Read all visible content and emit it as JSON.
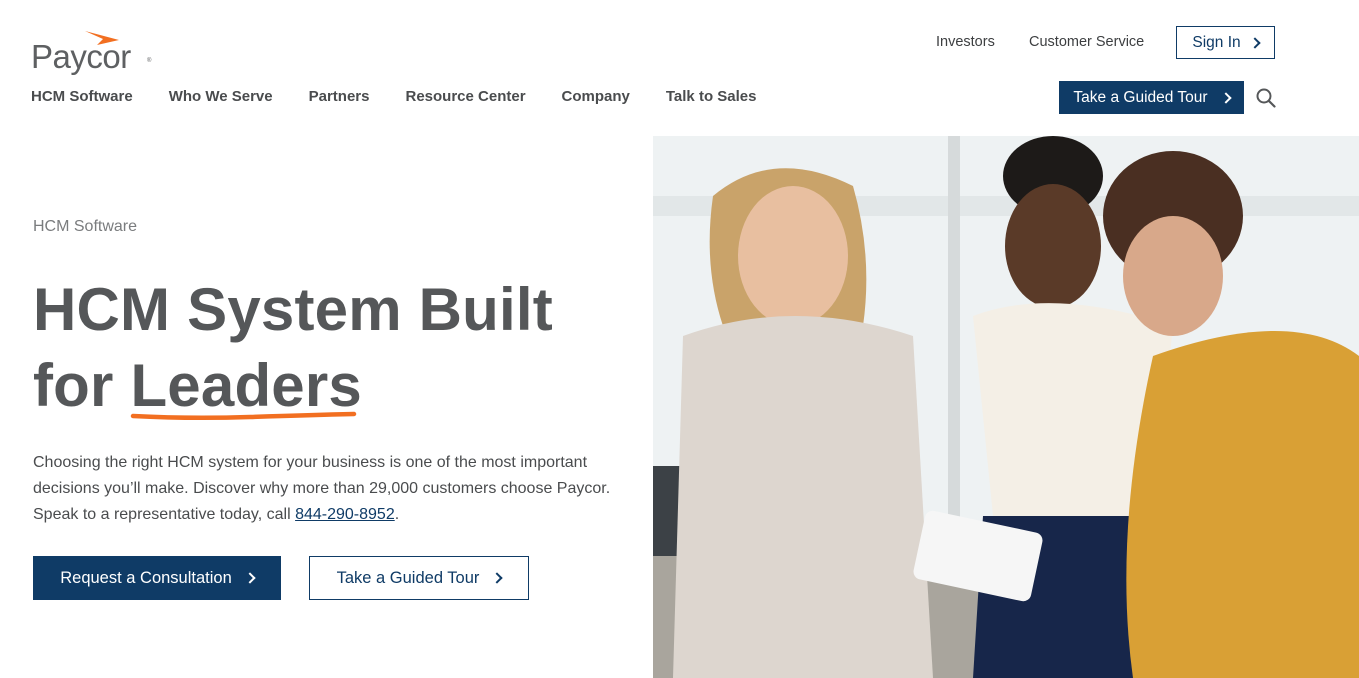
{
  "brand": {
    "name": "Paycor",
    "registered_mark": "®",
    "accent_color": "#f26f21",
    "primary_color": "#0f3b66",
    "text_color": "#555759"
  },
  "utility_nav": {
    "investors": "Investors",
    "customer_service": "Customer Service",
    "sign_in": "Sign In"
  },
  "main_nav": {
    "items": [
      {
        "label": "HCM Software"
      },
      {
        "label": "Who We Serve"
      },
      {
        "label": "Partners"
      },
      {
        "label": "Resource Center"
      },
      {
        "label": "Company"
      },
      {
        "label": "Talk to Sales"
      }
    ],
    "tour_button": "Take a Guided Tour",
    "search_icon": "search-icon"
  },
  "hero": {
    "eyebrow": "HCM Software",
    "headline_line1": "HCM System Built",
    "headline_line2_prefix": "for ",
    "headline_highlight": "Leaders",
    "body_text": "Choosing the right HCM system for your business is one of the most important decisions you’ll make. Discover why more than 29,000 customers choose Paycor. Speak to a representative today, call ",
    "phone": "844-290-8952",
    "body_suffix": ".",
    "primary_cta": "Request a Consultation",
    "secondary_cta": "Take a Guided Tour",
    "image_alt": "Three women smiling and looking at a tablet in an office"
  }
}
